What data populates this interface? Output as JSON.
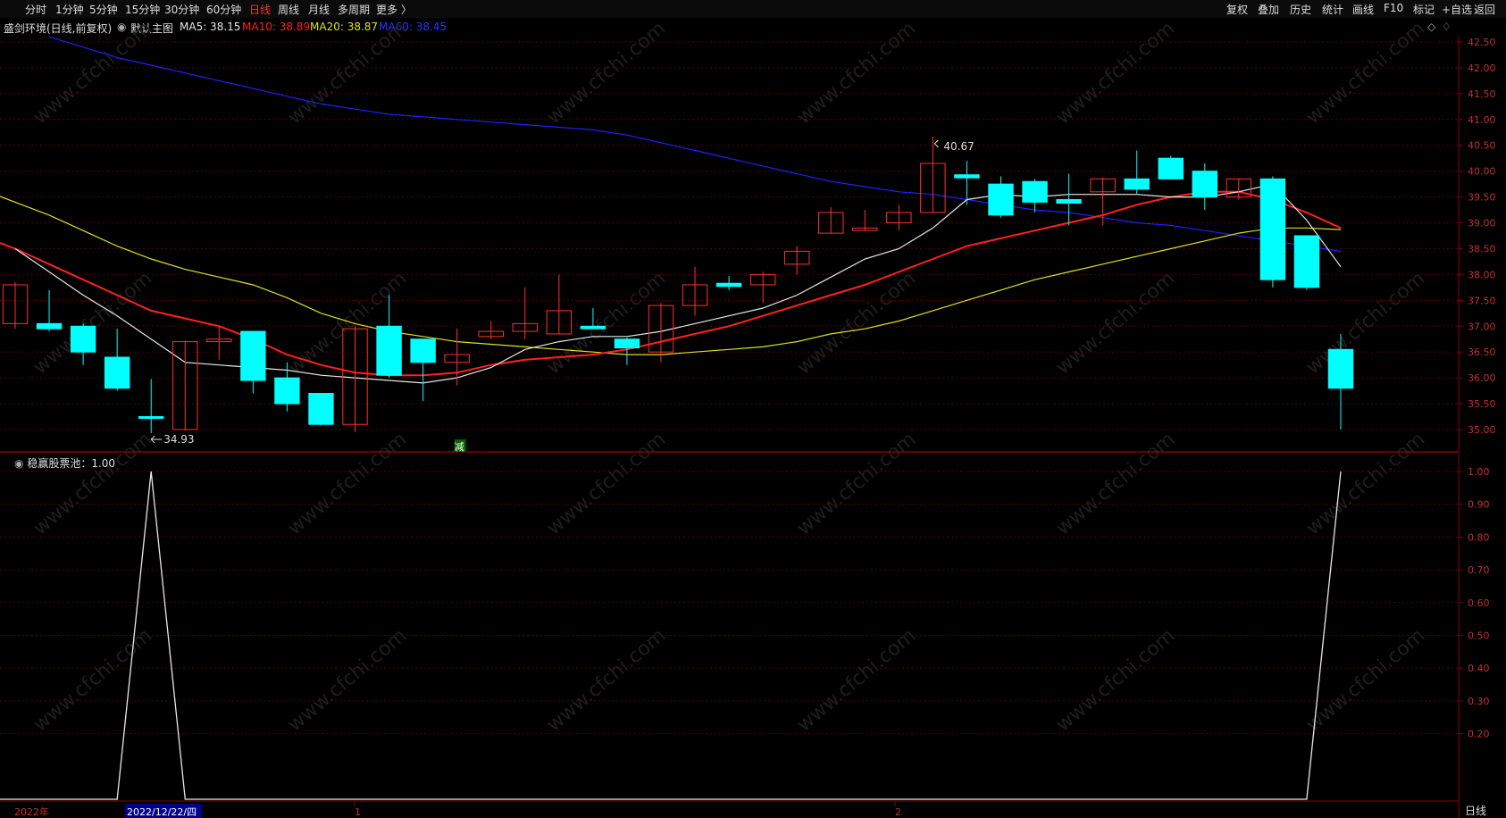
{
  "toolbar": {
    "left": [
      "分时",
      "1分钟",
      "5分钟",
      "15分钟",
      "30分钟",
      "60分钟",
      "日线",
      "周线",
      "月线",
      "多周期",
      "更多 〉"
    ],
    "active": "日线",
    "right": [
      "复权",
      "叠加",
      "历史",
      "统计",
      "画线",
      "F10",
      "标记",
      "+自选",
      "返回"
    ]
  },
  "info": {
    "stock": "盛剑环境(日线,前复权)",
    "main_chart": "默认主图",
    "ma5_label": "MA5: 38.15",
    "ma10_label": "MA10: 38.89",
    "ma20_label": "MA20: 38.87",
    "ma60_label": "MA60: 38.45"
  },
  "colors": {
    "up": "#ff3030",
    "down": "#00ffff",
    "ma5": "#e8e8e8",
    "ma10": "#ff2020",
    "ma20": "#e0e020",
    "ma60": "#2020ff",
    "grid": "#5a0000"
  },
  "annotations": {
    "high": "40.67",
    "low": "34.93",
    "reduce_mark": "减"
  },
  "sub_chart": {
    "label": "稳赢股票池：1.00"
  },
  "bottom": {
    "year": "2022年",
    "date_highlight": "2022/12/22/四",
    "month1": "1",
    "month2": "2",
    "period": "日线"
  },
  "watermark": "www.cfchi.com",
  "chart_data": [
    {
      "type": "candlestick",
      "title": "",
      "y_ticks": [
        "42.50",
        "42.00",
        "41.50",
        "41.00",
        "40.50",
        "40.00",
        "39.50",
        "39.00",
        "38.50",
        "38.00",
        "37.50",
        "37.00",
        "36.50",
        "36.00",
        "35.50",
        "35.00"
      ],
      "ylim": [
        34.6,
        42.7
      ],
      "candles": [
        {
          "o": 37.05,
          "c": 37.8,
          "h": 37.85,
          "l": 36.95
        },
        {
          "o": 37.05,
          "c": 36.95,
          "h": 37.7,
          "l": 36.9
        },
        {
          "o": 37.0,
          "c": 36.5,
          "h": 37.05,
          "l": 36.25
        },
        {
          "o": 36.4,
          "c": 35.8,
          "h": 36.95,
          "l": 35.75
        },
        {
          "o": 35.25,
          "c": 35.23,
          "h": 35.98,
          "l": 34.93
        },
        {
          "o": 35.0,
          "c": 36.7,
          "h": 36.72,
          "l": 34.98
        },
        {
          "o": 36.7,
          "c": 36.75,
          "h": 37.0,
          "l": 36.35
        },
        {
          "o": 36.9,
          "c": 35.95,
          "h": 36.9,
          "l": 35.7
        },
        {
          "o": 36.0,
          "c": 35.5,
          "h": 36.3,
          "l": 35.35
        },
        {
          "o": 35.7,
          "c": 35.1,
          "h": 35.7,
          "l": 35.08
        },
        {
          "o": 35.1,
          "c": 36.95,
          "h": 37.0,
          "l": 34.95
        },
        {
          "o": 37.0,
          "c": 36.05,
          "h": 37.6,
          "l": 36.0
        },
        {
          "o": 36.75,
          "c": 36.3,
          "h": 36.75,
          "l": 35.55
        },
        {
          "o": 36.3,
          "c": 36.45,
          "h": 36.95,
          "l": 35.85
        },
        {
          "o": 36.8,
          "c": 36.9,
          "h": 37.1,
          "l": 36.75
        },
        {
          "o": 36.9,
          "c": 37.05,
          "h": 37.75,
          "l": 36.75
        },
        {
          "o": 36.85,
          "c": 37.3,
          "h": 38.0,
          "l": 36.85
        },
        {
          "o": 37.0,
          "c": 36.95,
          "h": 37.35,
          "l": 36.95
        },
        {
          "o": 36.75,
          "c": 36.58,
          "h": 36.78,
          "l": 36.25
        },
        {
          "o": 36.5,
          "c": 37.4,
          "h": 37.45,
          "l": 36.3
        },
        {
          "o": 37.4,
          "c": 37.8,
          "h": 38.15,
          "l": 37.2
        },
        {
          "o": 37.83,
          "c": 37.77,
          "h": 37.97,
          "l": 37.7
        },
        {
          "o": 37.8,
          "c": 38.0,
          "h": 38.05,
          "l": 37.45
        },
        {
          "o": 38.2,
          "c": 38.45,
          "h": 38.55,
          "l": 38.0
        },
        {
          "o": 38.8,
          "c": 39.2,
          "h": 39.3,
          "l": 38.8
        },
        {
          "o": 38.85,
          "c": 38.9,
          "h": 39.25,
          "l": 38.85
        },
        {
          "o": 39.0,
          "c": 39.2,
          "h": 39.35,
          "l": 38.85
        },
        {
          "o": 39.2,
          "c": 40.15,
          "h": 40.67,
          "l": 39.2
        },
        {
          "o": 39.93,
          "c": 39.87,
          "h": 40.2,
          "l": 39.35
        },
        {
          "o": 39.75,
          "c": 39.15,
          "h": 39.9,
          "l": 39.1
        },
        {
          "o": 39.8,
          "c": 39.4,
          "h": 39.85,
          "l": 39.2
        },
        {
          "o": 39.45,
          "c": 39.38,
          "h": 39.95,
          "l": 38.95
        },
        {
          "o": 39.6,
          "c": 39.85,
          "h": 39.88,
          "l": 38.95
        },
        {
          "o": 39.85,
          "c": 39.65,
          "h": 40.4,
          "l": 39.55
        },
        {
          "o": 40.25,
          "c": 39.85,
          "h": 40.3,
          "l": 39.85
        },
        {
          "o": 40.0,
          "c": 39.5,
          "h": 40.15,
          "l": 39.25
        },
        {
          "o": 39.5,
          "c": 39.85,
          "h": 39.85,
          "l": 39.45
        },
        {
          "o": 39.85,
          "c": 37.9,
          "h": 39.9,
          "l": 37.75
        },
        {
          "o": 38.75,
          "c": 37.75,
          "h": 38.75,
          "l": 37.7
        },
        {
          "o": 36.55,
          "c": 35.8,
          "h": 36.85,
          "l": 35.0
        }
      ],
      "ma5": [
        38.5,
        38.05,
        37.6,
        37.2,
        36.75,
        36.3,
        36.25,
        36.2,
        36.15,
        36.05,
        36.0,
        35.95,
        35.9,
        36.0,
        36.2,
        36.55,
        36.7,
        36.8,
        36.8,
        36.9,
        37.05,
        37.2,
        37.35,
        37.6,
        37.95,
        38.3,
        38.5,
        38.9,
        39.45,
        39.55,
        39.5,
        39.55,
        39.55,
        39.55,
        39.5,
        39.5,
        39.6,
        39.75,
        39.05,
        38.15
      ],
      "ma10": [
        39.05,
        38.75,
        38.5,
        38.2,
        37.9,
        37.6,
        37.3,
        37.15,
        37.0,
        36.75,
        36.45,
        36.25,
        36.1,
        36.05,
        36.05,
        36.1,
        36.25,
        36.35,
        36.4,
        36.45,
        36.55,
        36.7,
        36.85,
        37.0,
        37.2,
        37.4,
        37.6,
        37.8,
        38.05,
        38.3,
        38.55,
        38.7,
        38.85,
        39.0,
        39.15,
        39.35,
        39.5,
        39.6,
        39.6,
        39.45,
        39.2,
        38.9
      ],
      "ma20": [
        39.65,
        39.4,
        39.15,
        38.85,
        38.55,
        38.3,
        38.1,
        37.95,
        37.8,
        37.55,
        37.25,
        37.05,
        36.9,
        36.8,
        36.7,
        36.65,
        36.6,
        36.55,
        36.5,
        36.45,
        36.45,
        36.5,
        36.55,
        36.6,
        36.7,
        36.85,
        36.95,
        37.1,
        37.3,
        37.5,
        37.7,
        37.9,
        38.05,
        38.2,
        38.35,
        38.5,
        38.65,
        38.8,
        38.9,
        38.9,
        38.87
      ],
      "ma60": [
        42.6,
        42.4,
        42.2,
        42.05,
        41.9,
        41.75,
        41.6,
        41.45,
        41.3,
        41.2,
        41.1,
        41.05,
        41.0,
        40.95,
        40.9,
        40.85,
        40.8,
        40.7,
        40.55,
        40.4,
        40.25,
        40.1,
        39.95,
        39.8,
        39.7,
        39.6,
        39.55,
        39.45,
        39.35,
        39.25,
        39.2,
        39.1,
        39.0,
        38.95,
        38.85,
        38.75,
        38.65,
        38.55,
        38.45
      ]
    },
    {
      "type": "line",
      "title": "稳赢股票池：1.00",
      "y_ticks": [
        "1.00",
        "0.90",
        "0.80",
        "0.70",
        "0.60",
        "0.50",
        "0.40",
        "0.30",
        "0.20"
      ],
      "ylim": [
        0,
        1.0
      ],
      "values": [
        0,
        0,
        0,
        0,
        1,
        0,
        0,
        0,
        0,
        0,
        0,
        0,
        0,
        0,
        0,
        0,
        0,
        0,
        0,
        0,
        0,
        0,
        0,
        0,
        0,
        0,
        0,
        0,
        0,
        0,
        0,
        0,
        0,
        0,
        0,
        0,
        0,
        0,
        0,
        1
      ]
    }
  ]
}
